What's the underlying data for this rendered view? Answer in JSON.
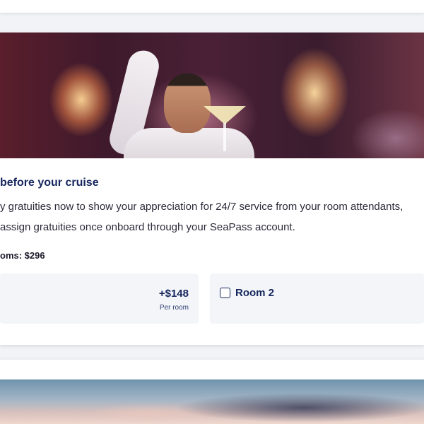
{
  "gratuities": {
    "title": "before your cruise",
    "description_lines": [
      "y gratuities now to show your appreciation for 24/7 service from your room attendants,",
      "assign gratuities once onboard through your SeaPass account."
    ],
    "total_label": "oms: $296"
  },
  "rooms": [
    {
      "price": "+$148",
      "price_note": "Per room",
      "checked": true
    },
    {
      "label": "Room 2",
      "checked": false
    }
  ],
  "colors": {
    "accent_navy": "#15265e",
    "card_background": "#ffffff",
    "option_background": "#f3f5f8",
    "page_background": "#f1f3f6"
  }
}
